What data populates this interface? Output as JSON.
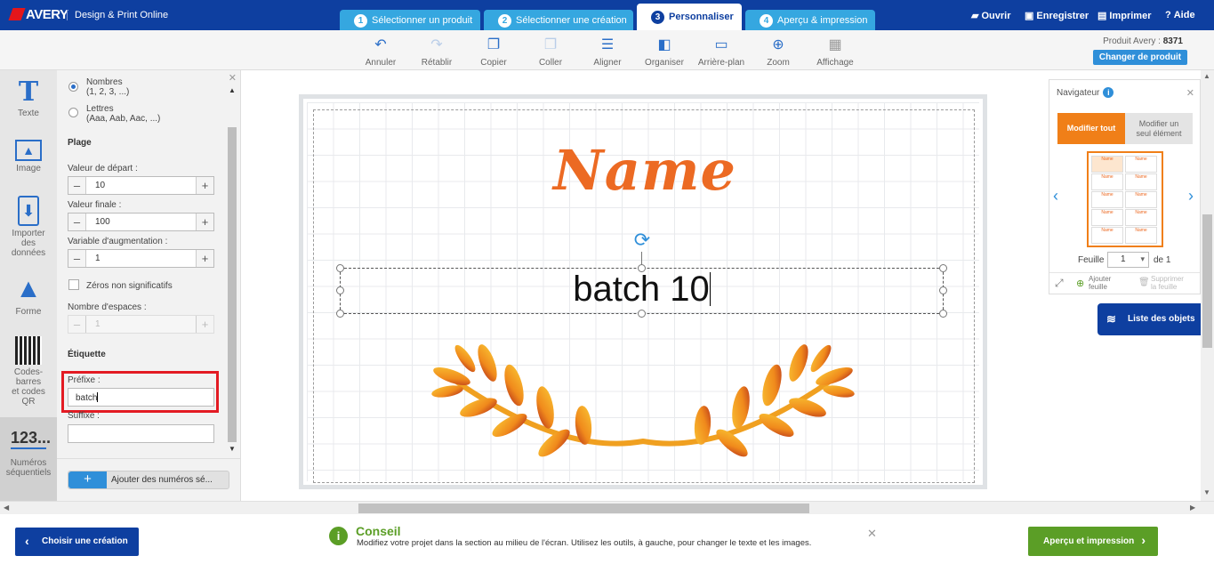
{
  "brand": {
    "logo": "AVERY",
    "app_name": "Design & Print Online"
  },
  "steps": [
    {
      "num": "1",
      "label": "Sélectionner un produit"
    },
    {
      "num": "2",
      "label": "Sélectionner une création"
    },
    {
      "num": "3",
      "label": "Personnaliser"
    },
    {
      "num": "4",
      "label": "Aperçu & impression"
    }
  ],
  "top_actions": {
    "open": "Ouvrir",
    "save": "Enregistrer",
    "print": "Imprimer",
    "help": "Aide"
  },
  "toolbar": {
    "undo": "Annuler",
    "redo": "Rétablir",
    "copy": "Copier",
    "paste": "Coller",
    "align": "Aligner",
    "arrange": "Organiser",
    "background": "Arrière-plan",
    "zoom": "Zoom",
    "view": "Affichage"
  },
  "product": {
    "label": "Produit Avery :",
    "code": "8371",
    "change_button": "Changer de produit"
  },
  "left_tools": {
    "text": "Texte",
    "image": "Image",
    "import": [
      "Importer",
      "des",
      "données"
    ],
    "shape": "Forme",
    "barcodes": [
      "Codes-",
      "barres",
      "et codes",
      "QR"
    ],
    "seq_icon_label": "123...",
    "seq": [
      "Numéros",
      "séquentiels"
    ]
  },
  "panel": {
    "numbers_option": "Nombres",
    "numbers_example": "(1, 2, 3, ...)",
    "letters_option": "Lettres",
    "letters_example": "(Aaa, Aab, Aac, ...)",
    "range_heading": "Plage",
    "start_label": "Valeur de départ :",
    "start_value": "10",
    "end_label": "Valeur finale :",
    "end_value": "100",
    "increment_label": "Variable d'augmentation :",
    "increment_value": "1",
    "leading_zeros_label": "Zéros non significatifs",
    "spaces_label": "Nombre d'espaces :",
    "spaces_value": "1",
    "label_heading": "Étiquette",
    "prefix_label": "Préfixe :",
    "prefix_value": "batch",
    "suffix_label": "Suffixe :",
    "suffix_value": "",
    "add_button": "Ajouter des numéros sé..."
  },
  "canvas": {
    "title": "Name",
    "selected_text": "batch 10"
  },
  "navigator": {
    "title": "Navigateur",
    "tab_all": "Modifier tout",
    "tab_one": [
      "Modifier un",
      "seul élément"
    ],
    "thumb_label": "Name",
    "sheet_label": "Feuille",
    "sheet_value": "1",
    "sheet_of": "de 1",
    "add_sheet": [
      "Ajouter",
      "feuille"
    ],
    "delete_sheet": [
      "Supprimer",
      "la feuille"
    ]
  },
  "object_list": "Liste des objets",
  "footer": {
    "back_button": "Choisir une création",
    "tip_title": "Conseil",
    "tip_text": "Modifiez votre projet dans la section au milieu de l'écran. Utilisez les outils, à gauche, pour changer le texte et les images.",
    "next_button": "Aperçu et impression"
  },
  "colors": {
    "primary_blue": "#0e3fa0",
    "accent_orange": "#ec6a23",
    "success_green": "#5b9e26",
    "highlight_red": "#e31b23"
  }
}
